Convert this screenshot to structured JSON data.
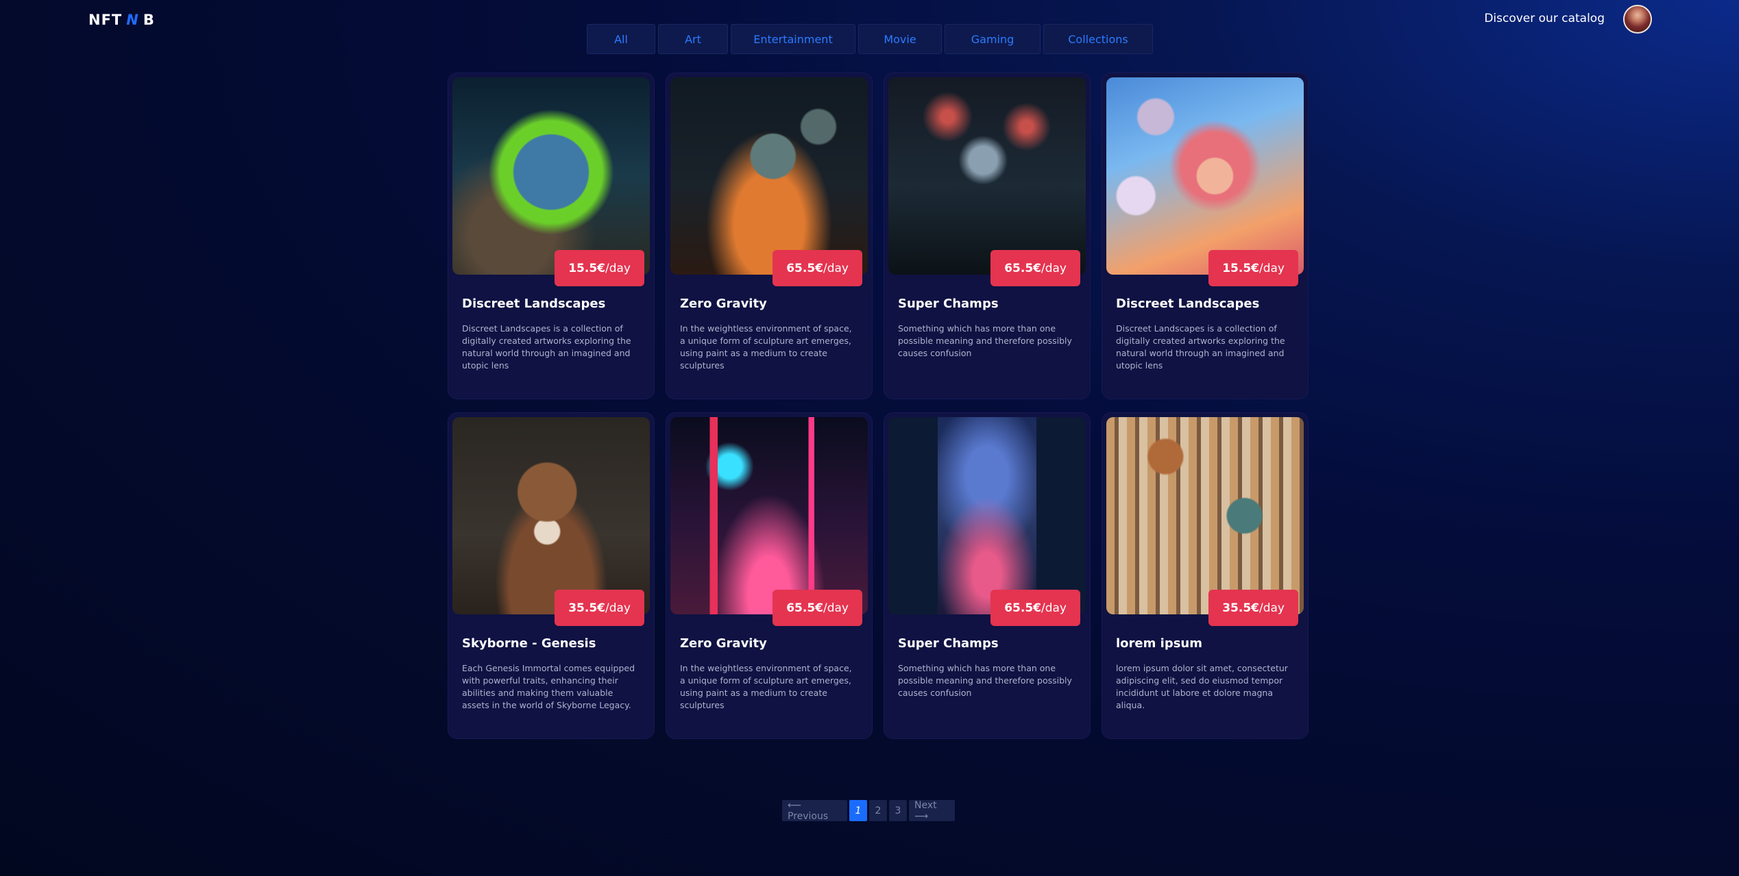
{
  "header": {
    "logo": {
      "part1": "NFT",
      "part2": "N",
      "part3": "B"
    },
    "catalog_link": "Discover our catalog"
  },
  "filters": [
    {
      "label": "All"
    },
    {
      "label": "Art"
    },
    {
      "label": "Entertainment"
    },
    {
      "label": "Movie"
    },
    {
      "label": "Gaming"
    },
    {
      "label": "Collections"
    }
  ],
  "cards": [
    {
      "title": "Discreet Landscapes",
      "price": "15.5€",
      "unit": "/day",
      "desc": "Discreet Landscapes is a collection of digitally created artworks exploring the natural world through an imagined and utopic lens"
    },
    {
      "title": "Zero Gravity",
      "price": "65.5€",
      "unit": "/day",
      "desc": "In the weightless environment of space, a unique form of sculpture art emerges, using paint as a medium to create sculptures"
    },
    {
      "title": "Super Champs",
      "price": "65.5€",
      "unit": "/day",
      "desc": "Something which has more than one possible meaning and therefore possibly causes confusion"
    },
    {
      "title": "Discreet Landscapes",
      "price": "15.5€",
      "unit": "/day",
      "desc": "Discreet Landscapes is a collection of digitally created artworks exploring the natural world through an imagined and utopic lens"
    },
    {
      "title": "Skyborne - Genesis",
      "price": "35.5€",
      "unit": "/day",
      "desc": "Each Genesis Immortal comes equipped with powerful traits, enhancing their abilities and making them valuable assets in the world of Skyborne Legacy."
    },
    {
      "title": "Zero Gravity",
      "price": "65.5€",
      "unit": "/day",
      "desc": "In the weightless environment of space, a unique form of sculpture art emerges, using paint as a medium to create sculptures"
    },
    {
      "title": "Super Champs",
      "price": "65.5€",
      "unit": "/day",
      "desc": "Something which has more than one possible meaning and therefore possibly causes confusion"
    },
    {
      "title": "lorem ipsum",
      "price": "35.5€",
      "unit": "/day",
      "desc": "lorem ipsum dolor sit amet, consectetur adipiscing elit, sed do eiusmod tempor incididunt ut labore et dolore magna aliqua."
    }
  ],
  "pagination": {
    "previous": "⟵ Previous",
    "pages": [
      "1",
      "2",
      "3"
    ],
    "next": "Next ⟶",
    "current": "1"
  },
  "colors": {
    "accent": "#1a6cff",
    "price_badge": "#e43450",
    "card_bg": "#0f1242"
  }
}
